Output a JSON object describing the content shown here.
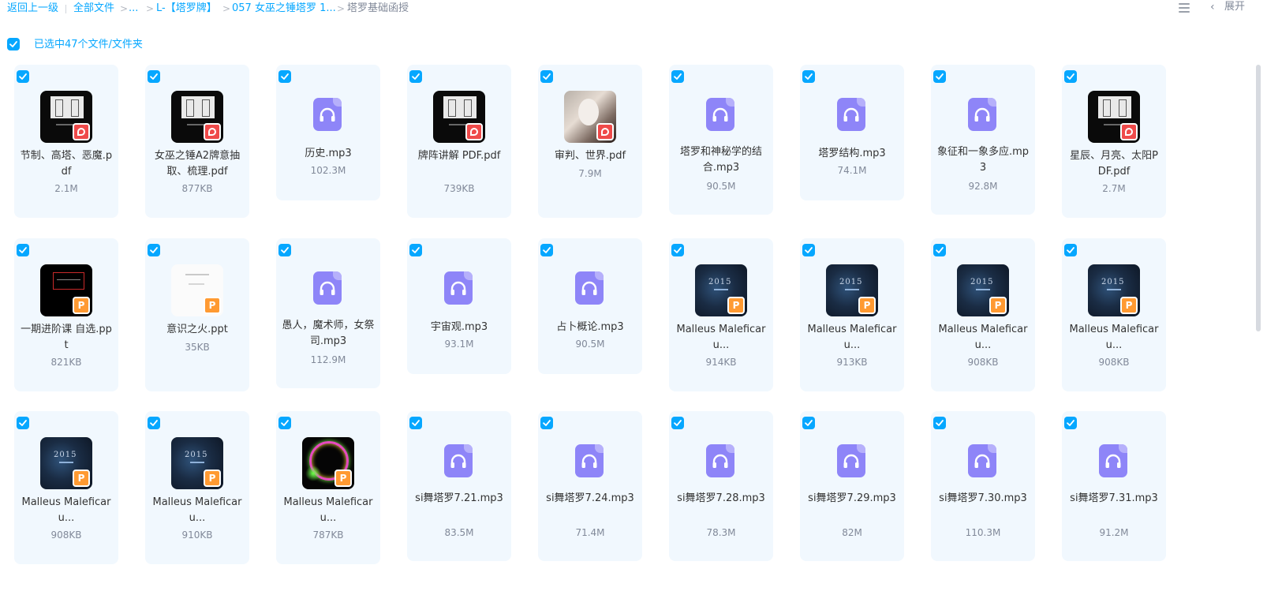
{
  "breadcrumb": {
    "back": "返回上一级",
    "all_files": "全部文件",
    "ellipsis": "...",
    "folder1": "L-【塔罗牌】",
    "folder2": "057 女巫之锤塔罗 1...",
    "current": "塔罗基础函授",
    "separator": ">"
  },
  "toolbar": {
    "expand_label": "展开",
    "list_icon": "list-view-icon",
    "collapse_icon": "chevron-left-icon"
  },
  "selection": {
    "label": "已选中47个文件/文件夹"
  },
  "colors": {
    "accent": "#06a7ff",
    "card_bg": "#f1f8fe",
    "audio_icon": "#8e85f8",
    "pdf_badge": "#ef4a4a",
    "ppt_badge": "#ff9a32"
  },
  "files": [
    {
      "name": "节制、高塔、恶魔.pdf",
      "size": "2.1M",
      "type": "pdf",
      "thumb": "doc"
    },
    {
      "name": "女巫之锤A2牌意抽取、梳理.pdf",
      "size": "877KB",
      "type": "pdf",
      "thumb": "doc"
    },
    {
      "name": "历史.mp3",
      "size": "102.3M",
      "type": "audio"
    },
    {
      "name": "牌阵讲解 PDF.pdf",
      "size": "739KB",
      "type": "pdf",
      "thumb": "doc"
    },
    {
      "name": "审判、世界.pdf",
      "size": "7.9M",
      "type": "pdf",
      "thumb": "photo"
    },
    {
      "name": "塔罗和神秘学的结合.mp3",
      "size": "90.5M",
      "type": "audio"
    },
    {
      "name": "塔罗结构.mp3",
      "size": "74.1M",
      "type": "audio"
    },
    {
      "name": "象征和一象多应.mp3",
      "size": "92.8M",
      "type": "audio"
    },
    {
      "name": "星辰、月亮、太阳PDF.pdf",
      "size": "2.7M",
      "type": "pdf",
      "thumb": "doc"
    },
    {
      "name": "一期进阶课 自选.ppt",
      "size": "821KB",
      "type": "ppt",
      "thumb": "ppt-dark"
    },
    {
      "name": "意识之火.ppt",
      "size": "35KB",
      "type": "ppt",
      "thumb": "ppt-white"
    },
    {
      "name": "愚人，魔术师，女祭司.mp3",
      "size": "112.9M",
      "type": "audio"
    },
    {
      "name": "宇宙观.mp3",
      "size": "93.1M",
      "type": "audio"
    },
    {
      "name": "占卜概论.mp3",
      "size": "90.5M",
      "type": "audio"
    },
    {
      "name": "Malleus Maleficaru...",
      "size": "914KB",
      "type": "ppt",
      "thumb": "space"
    },
    {
      "name": "Malleus Maleficaru...",
      "size": "913KB",
      "type": "ppt",
      "thumb": "space"
    },
    {
      "name": "Malleus Maleficaru...",
      "size": "908KB",
      "type": "ppt",
      "thumb": "space"
    },
    {
      "name": "Malleus Maleficaru...",
      "size": "908KB",
      "type": "ppt",
      "thumb": "space"
    },
    {
      "name": "Malleus Maleficaru...",
      "size": "908KB",
      "type": "ppt",
      "thumb": "space"
    },
    {
      "name": "Malleus Maleficaru...",
      "size": "910KB",
      "type": "ppt",
      "thumb": "space"
    },
    {
      "name": "Malleus Maleficaru...",
      "size": "787KB",
      "type": "ppt",
      "thumb": "neon"
    },
    {
      "name": "si舞塔罗7.21.mp3",
      "size": "83.5M",
      "type": "audio"
    },
    {
      "name": "si舞塔罗7.24.mp3",
      "size": "71.4M",
      "type": "audio"
    },
    {
      "name": "si舞塔罗7.28.mp3",
      "size": "78.3M",
      "type": "audio"
    },
    {
      "name": "si舞塔罗7.29.mp3",
      "size": "82M",
      "type": "audio"
    },
    {
      "name": "si舞塔罗7.30.mp3",
      "size": "110.3M",
      "type": "audio"
    },
    {
      "name": "si舞塔罗7.31.mp3",
      "size": "91.2M",
      "type": "audio"
    }
  ]
}
